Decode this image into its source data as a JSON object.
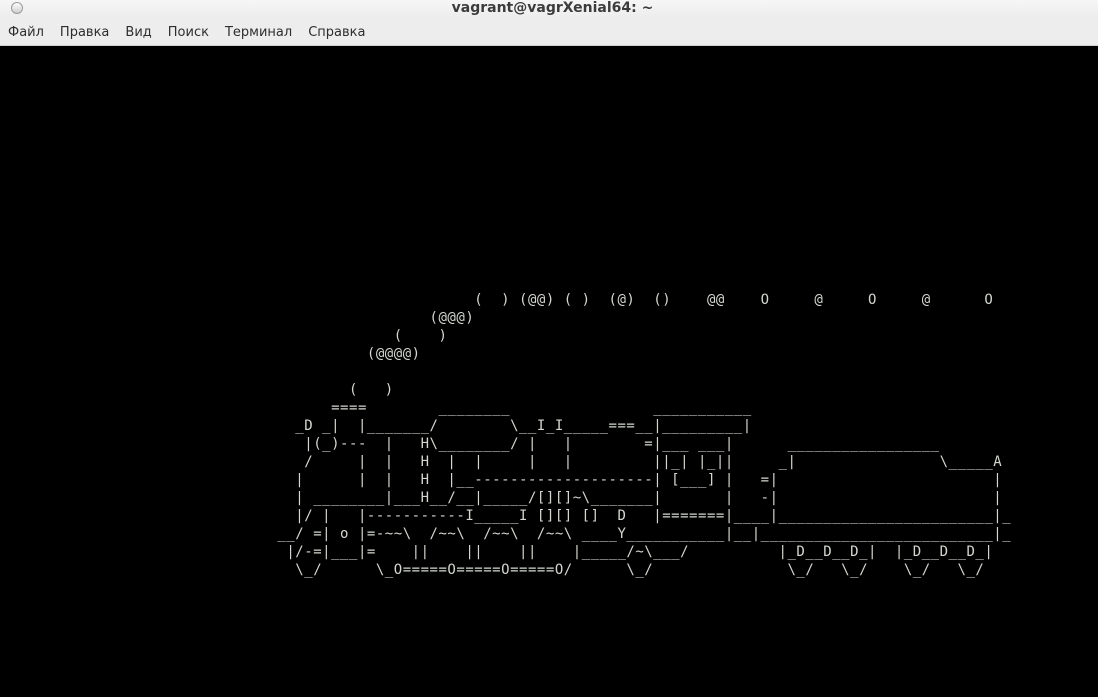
{
  "window": {
    "title": "vagrant@vagrXenial64: ~"
  },
  "menu": {
    "items": [
      "Файл",
      "Правка",
      "Вид",
      "Поиск",
      "Терминал",
      "Справка"
    ]
  },
  "terminal": {
    "lines": [
      "                                                     (  ) (@@) ( )  (@)  ()    @@    O     @     O     @      O",
      "                                                (@@@)",
      "                                            (    )",
      "                                         (@@@@)",
      "",
      "                                       (   )",
      "                                     ====        ________                ___________",
      "                                 _D _|  |_______/        \\__I_I_____===__|_________|",
      "                                  |(_)---  |   H\\________/ |   |        =|___ ___|      _________________",
      "                                  /     |  |   H  |  |     |   |         ||_| |_||     _|                \\_____A",
      "                                 |      |  |   H  |__--------------------| [___] |   =|                        |",
      "                                 | ________|___H__/__|_____/[][]~\\_______|       |   -|                        |",
      "                                 |/ |   |-----------I_____I [][] []  D   |=======|____|________________________|_",
      "                               __/ =| o |=-~~\\  /~~\\  /~~\\  /~~\\ ____Y___________|__|__________________________|_",
      "                                |/-=|___|=    ||    ||    ||    |_____/~\\___/          |_D__D__D_|  |_D__D__D_|",
      "                                 \\_/      \\_O=====O=====O=====O/      \\_/               \\_/   \\_/    \\_/   \\_/"
    ]
  }
}
